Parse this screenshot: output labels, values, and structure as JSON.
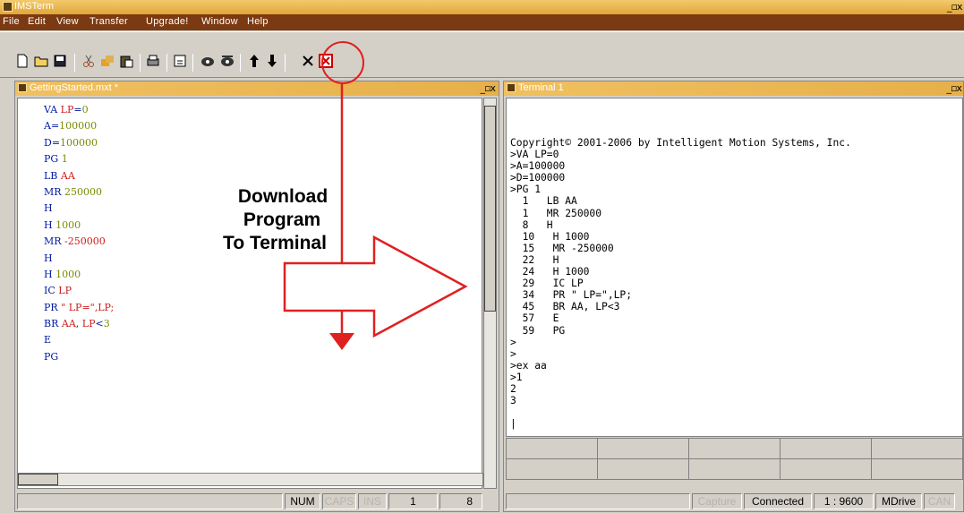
{
  "app": {
    "title": "IMSTerm"
  },
  "menu": [
    "File",
    "Edit",
    "View",
    "Transfer",
    "Upgrade!",
    "Window",
    "Help"
  ],
  "editor": {
    "title": "GettingStarted.mxt *",
    "lines": [
      [
        [
          "k",
          "VA "
        ],
        [
          "v",
          "LP"
        ],
        [
          "k",
          "="
        ],
        [
          "n",
          "0"
        ]
      ],
      [
        [
          "k",
          "A="
        ],
        [
          "n",
          "100000"
        ]
      ],
      [
        [
          "k",
          "D="
        ],
        [
          "n",
          "100000"
        ]
      ],
      [
        [
          "k",
          "PG "
        ],
        [
          "n",
          "1"
        ]
      ],
      [
        [
          "k",
          "LB "
        ],
        [
          "v",
          "AA"
        ]
      ],
      [
        [
          "k",
          "MR "
        ],
        [
          "n",
          "250000"
        ]
      ],
      [
        [
          "k",
          "H"
        ]
      ],
      [
        [
          "k",
          "H "
        ],
        [
          "n",
          "1000"
        ]
      ],
      [
        [
          "k",
          "MR "
        ],
        [
          "v",
          "-250000"
        ]
      ],
      [
        [
          "k",
          "H"
        ]
      ],
      [
        [
          "k",
          "H "
        ],
        [
          "n",
          "1000"
        ]
      ],
      [
        [
          "k",
          "IC "
        ],
        [
          "v",
          "LP"
        ]
      ],
      [
        [
          "k",
          "PR "
        ],
        [
          "v",
          "\" LP=\",LP;"
        ]
      ],
      [
        [
          "k",
          "BR "
        ],
        [
          "v",
          "AA"
        ],
        [
          "k",
          ", "
        ],
        [
          "v",
          "LP"
        ],
        [
          "k",
          "<"
        ],
        [
          "n",
          "3"
        ]
      ],
      [
        [
          "k",
          "E"
        ]
      ],
      [
        [
          "k",
          "PG"
        ]
      ]
    ],
    "status": {
      "num": "NUM",
      "caps": "CAPS",
      "ins": "INS",
      "line": "1",
      "col": "8"
    }
  },
  "annotation": {
    "line1": "Download",
    "line2": "Program",
    "line3": "To Terminal"
  },
  "terminal": {
    "title": "Terminal 1",
    "text": "Copyright© 2001-2006 by Intelligent Motion Systems, Inc.\n>VA LP=0\n>A=100000\n>D=100000\n>PG 1\n  1   LB AA\n  1   MR 250000\n  8   H\n  10   H 1000\n  15   MR -250000\n  22   H\n  24   H 1000\n  29   IC LP\n  34   PR \" LP=\",LP;\n  45   BR AA, LP<3\n  57   E\n  59   PG\n>\n>\n>ex aa\n>1\n2\n3\n\n|",
    "status": {
      "capture": "Capture",
      "connected": "Connected",
      "baud": "1 : 9600",
      "device": "MDrive",
      "can": "CAN"
    }
  },
  "colors": {
    "title": "#e6b04a",
    "menu": "#7b3a12",
    "annotation": "#e02020"
  }
}
